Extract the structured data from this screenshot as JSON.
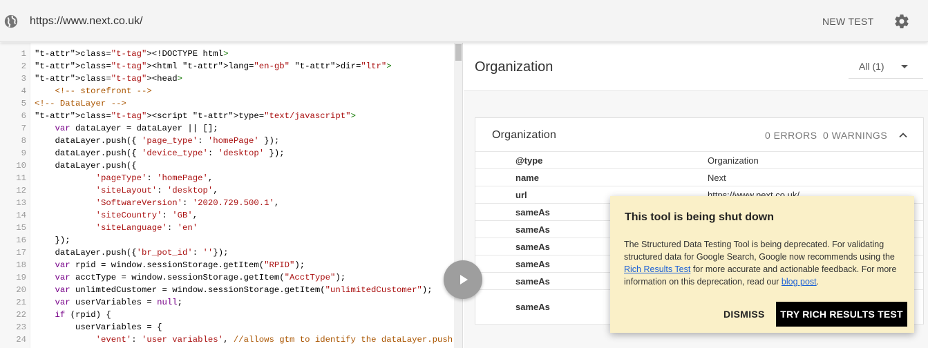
{
  "topbar": {
    "url_value": "https://www.next.co.uk/",
    "new_test_label": "NEW TEST",
    "icons": [
      "globe-icon",
      "gear-icon"
    ]
  },
  "editor": {
    "lines": [
      {
        "n": "1",
        "text": "<!DOCTYPE html>"
      },
      {
        "n": "2",
        "text": "<html lang=\"en-gb\" dir=\"ltr\">"
      },
      {
        "n": "3",
        "text": "<head>"
      },
      {
        "n": "4",
        "text": "    <!-- storefront -->"
      },
      {
        "n": "5",
        "text": "<!-- DataLayer -->"
      },
      {
        "n": "6",
        "text": "<script type=\"text/javascript\">"
      },
      {
        "n": "7",
        "text": "    var dataLayer = dataLayer || [];"
      },
      {
        "n": "8",
        "text": "    dataLayer.push({ 'page_type': 'homePage' });"
      },
      {
        "n": "9",
        "text": "    dataLayer.push({ 'device_type': 'desktop' });"
      },
      {
        "n": "10",
        "text": "    dataLayer.push({"
      },
      {
        "n": "11",
        "text": "            'pageType': 'homePage',"
      },
      {
        "n": "12",
        "text": "            'siteLayout': 'desktop',"
      },
      {
        "n": "13",
        "text": "            'SoftwareVersion': '2020.729.500.1',"
      },
      {
        "n": "14",
        "text": "            'siteCountry': 'GB',"
      },
      {
        "n": "15",
        "text": "            'siteLanguage': 'en'"
      },
      {
        "n": "16",
        "text": "    });"
      },
      {
        "n": "17",
        "text": "    dataLayer.push({'br_pot_id': ''});"
      },
      {
        "n": "18",
        "text": "    var rpid = window.sessionStorage.getItem(\"RPID\");"
      },
      {
        "n": "19",
        "text": "    var acctType = window.sessionStorage.getItem(\"AcctType\");"
      },
      {
        "n": "20",
        "text": "    var unlimtedCustomer = window.sessionStorage.getItem(\"unlimitedCustomer\");"
      },
      {
        "n": "21",
        "text": "    var userVariables = null;"
      },
      {
        "n": "22",
        "text": "    if (rpid) {"
      },
      {
        "n": "23",
        "text": "        userVariables = {"
      },
      {
        "n": "24",
        "text": "            'event': 'user variables', //allows gtm to identify the dataLayer.push"
      }
    ]
  },
  "results": {
    "title": "Organization",
    "filter_label": "All (1)",
    "card": {
      "title": "Organization",
      "errors": "0 ERRORS",
      "warnings": "0 WARNINGS",
      "rows": [
        {
          "key": "@type",
          "value": "Organization"
        },
        {
          "key": "name",
          "value": "Next"
        },
        {
          "key": "url",
          "value": "https://www.next.co.uk/"
        },
        {
          "key": "sameAs",
          "value": ""
        },
        {
          "key": "sameAs",
          "value": ""
        },
        {
          "key": "sameAs",
          "value": ""
        },
        {
          "key": "sameAs",
          "value": ""
        },
        {
          "key": "sameAs",
          "value": ""
        },
        {
          "key": "sameAs",
          "value": ""
        }
      ]
    }
  },
  "dialog": {
    "title": "This tool is being shut down",
    "body_1": "The Structured Data Testing Tool is being deprecated. For validating structured data for Google Search, Google now recommends using the ",
    "link_1": "Rich Results Test",
    "body_2": " for more accurate and actionable feedback. For more information on this deprecation, read our ",
    "link_2": "blog post",
    "body_3": ".",
    "dismiss_label": "DISMISS",
    "try_label": "TRY RICH RESULTS TEST"
  }
}
